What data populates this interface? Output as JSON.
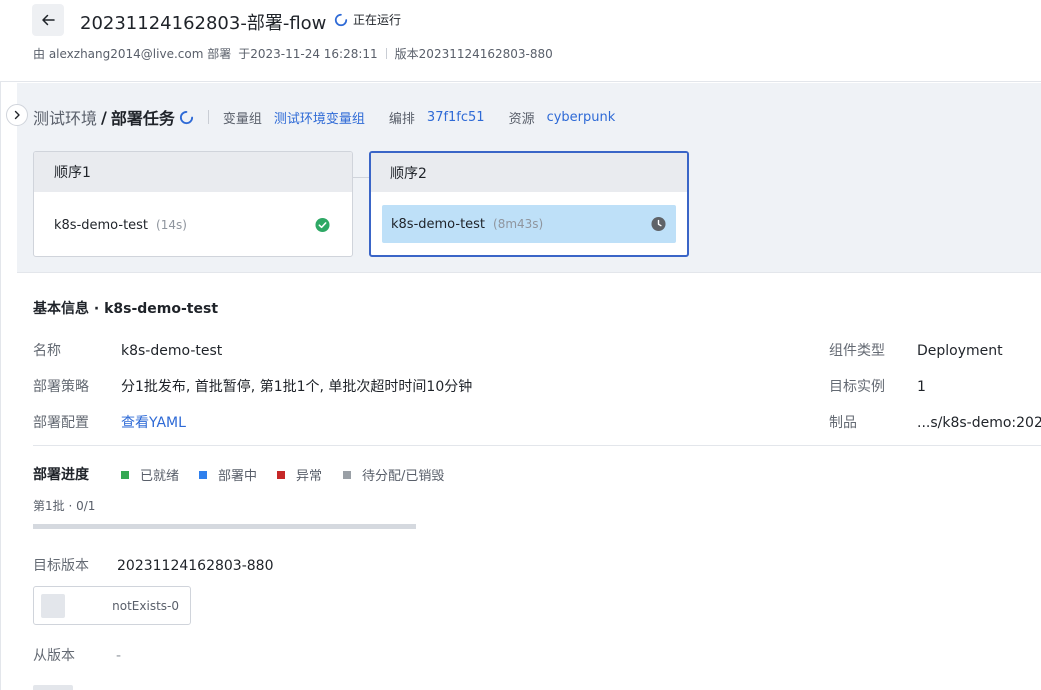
{
  "header": {
    "title": "20231124162803-部署-flow",
    "status": "正在运行",
    "meta": {
      "by": "由 alexzhang2014@live.com 部署",
      "at": "于2023-11-24 16:28:11",
      "version": "版本20231124162803-880"
    }
  },
  "pipeline": {
    "env": "测试环境",
    "slash": "/",
    "task": "部署任务",
    "var_group_label": "变量组",
    "var_group_value": "测试环境变量组",
    "orchestration_label": "编排",
    "orchestration_value": "37f1fc51",
    "resource_label": "资源",
    "resource_value": "cyberpunk",
    "stages": [
      {
        "title": "顺序1",
        "job": "k8s-demo-test",
        "duration": "(14s)",
        "status": "success"
      },
      {
        "title": "顺序2",
        "job": "k8s-demo-test",
        "duration": "(8m43s)",
        "status": "running"
      }
    ]
  },
  "info": {
    "section_title": "基本信息 · k8s-demo-test",
    "name_label": "名称",
    "name_value": "k8s-demo-test",
    "strategy_label": "部署策略",
    "strategy_value": "分1批发布, 首批暂停, 第1批1个, 单批次超时时间10分钟",
    "config_label": "部署配置",
    "config_value": "查看YAML",
    "component_type_label": "组件类型",
    "component_type_value": "Deployment",
    "target_instances_label": "目标实例",
    "target_instances_value": "1",
    "artifact_label": "制品",
    "artifact_value": "...s/k8s-demo:202"
  },
  "progress": {
    "title": "部署进度",
    "legend": [
      {
        "label": "已就绪",
        "color": "#34a853"
      },
      {
        "label": "部署中",
        "color": "#2f80ed"
      },
      {
        "label": "异常",
        "color": "#c62828"
      },
      {
        "label": "待分配/已销毁",
        "color": "#9aa0a6"
      }
    ],
    "batch_label": "第1批 · 0/1",
    "fraction": 0,
    "target_version_label": "目标版本",
    "target_version_value": "20231124162803-880",
    "instance_name": "notExists-0",
    "from_version_label": "从版本",
    "from_version_value": "-"
  },
  "icons": {
    "back": "arrow-left-icon",
    "running": "spinner-icon",
    "success": "check-circle-icon",
    "pending": "clock-icon",
    "toggle": "chevron-right-icon"
  }
}
